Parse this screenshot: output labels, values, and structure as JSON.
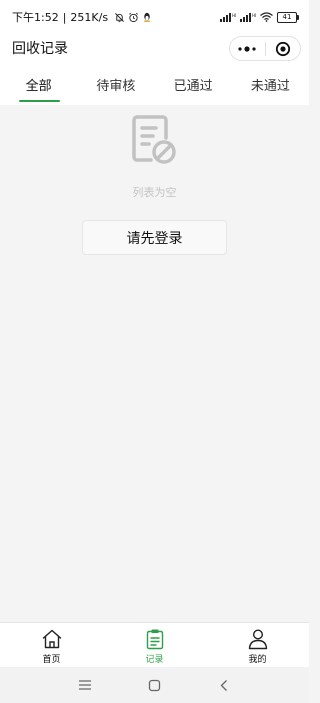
{
  "status_bar": {
    "time": "下午1:52",
    "separator": "|",
    "net_speed": "251K/s",
    "battery": "41",
    "icons": [
      "mute-bell-icon",
      "alarm-icon",
      "qq-penguin-icon",
      "signal-icon",
      "signal-icon",
      "wifi-icon",
      "battery-icon"
    ]
  },
  "header": {
    "title": "回收记录",
    "menu_glyph": "•●•",
    "close_glyph": "◉"
  },
  "tabs": [
    {
      "label": "全部",
      "active": true
    },
    {
      "label": "待审核",
      "active": false
    },
    {
      "label": "已通过",
      "active": false
    },
    {
      "label": "未通过",
      "active": false
    }
  ],
  "empty_state": {
    "icon": "document-forbidden-icon",
    "text": "列表为空",
    "login_button": "请先登录"
  },
  "tabbar": [
    {
      "label": "首页",
      "icon": "home-icon",
      "active": false
    },
    {
      "label": "记录",
      "icon": "clipboard-icon",
      "active": true
    },
    {
      "label": "我的",
      "icon": "user-icon",
      "active": false
    }
  ],
  "colors": {
    "accent": "#2e9e48",
    "background": "#f4f4f4",
    "empty_text": "#c4c4c4"
  }
}
